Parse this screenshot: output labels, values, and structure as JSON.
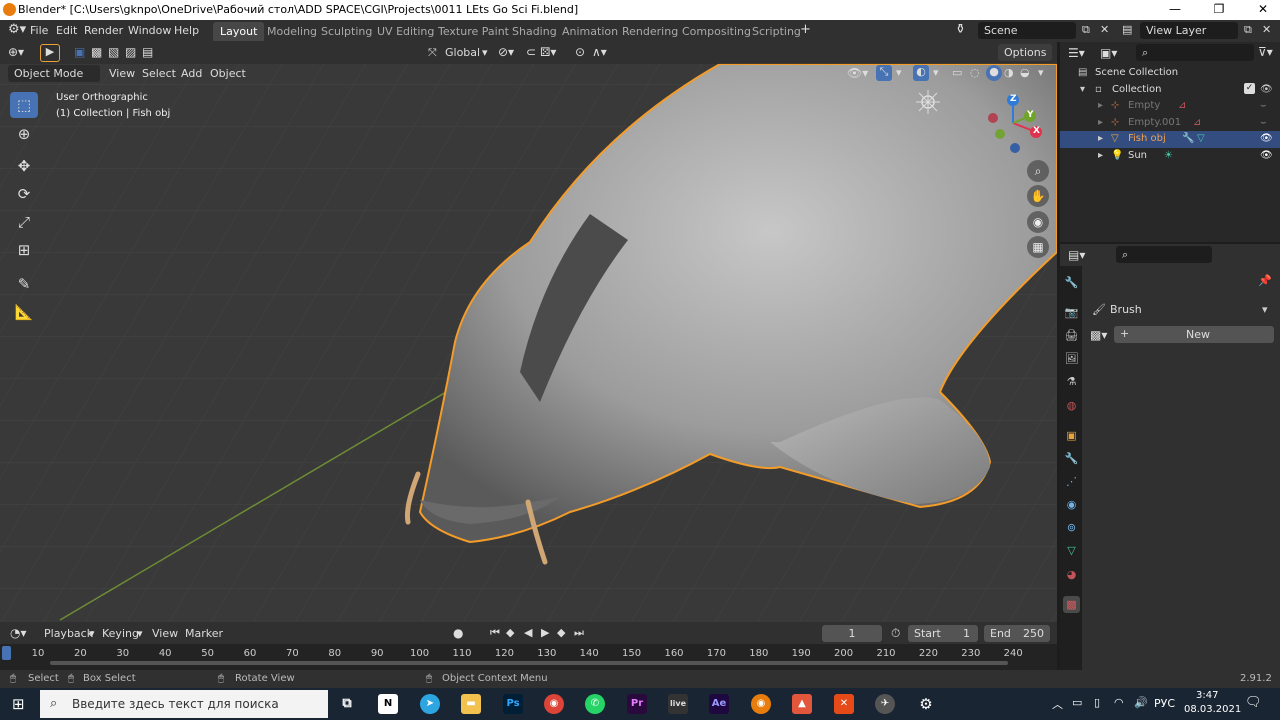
{
  "window": {
    "title": "Blender* [C:\\Users\\gknpo\\OneDrive\\Рабочий стол\\ADD SPACE\\CGI\\Projects\\0011 LEts Go Sci Fi.blend]"
  },
  "menu": {
    "file": "File",
    "edit": "Edit",
    "render": "Render",
    "window": "Window",
    "help": "Help"
  },
  "workspaces": [
    "Layout",
    "Modeling",
    "Sculpting",
    "UV Editing",
    "Texture Paint",
    "Shading",
    "Animation",
    "Rendering",
    "Compositing",
    "Scripting"
  ],
  "scene": {
    "name": "Scene",
    "view_layer": "View Layer"
  },
  "viewport": {
    "mode": "Object Mode",
    "view": "View",
    "select": "Select",
    "add": "Add",
    "object": "Object",
    "orientation": "Global",
    "options": "Options",
    "view_name": "User Orthographic",
    "collection_info": "(1) Collection | Fish obj"
  },
  "gizmo": {
    "x": "X",
    "y": "Y",
    "z": "Z"
  },
  "outliner": {
    "root": "Scene Collection",
    "collection": "Collection",
    "items": [
      "Empty",
      "Empty.001",
      "Fish obj",
      "Sun"
    ]
  },
  "properties": {
    "brush_label": "Brush",
    "new_button": "New"
  },
  "timeline": {
    "playback": "Playback",
    "keying": "Keying",
    "view": "View",
    "marker": "Marker",
    "current_frame": "1",
    "start_label": "Start",
    "start": "1",
    "end_label": "End",
    "end": "250",
    "ticks": [
      "10",
      "20",
      "30",
      "40",
      "50",
      "60",
      "70",
      "80",
      "90",
      "100",
      "110",
      "120",
      "130",
      "140",
      "150",
      "160",
      "170",
      "180",
      "190",
      "200",
      "210",
      "220",
      "230",
      "240"
    ]
  },
  "status": {
    "select": "Select",
    "box_select": "Box Select",
    "rotate_view": "Rotate View",
    "context_menu": "Object Context Menu",
    "version": "2.91.2"
  },
  "taskbar": {
    "search_placeholder": "Введите здесь текст для поиска",
    "lang": "РУС",
    "time": "3:47",
    "date": "08.03.2021"
  },
  "colors": {
    "accent": "#4772b3",
    "selection_outline": "#f39c2a",
    "active_tab": "#474747"
  }
}
